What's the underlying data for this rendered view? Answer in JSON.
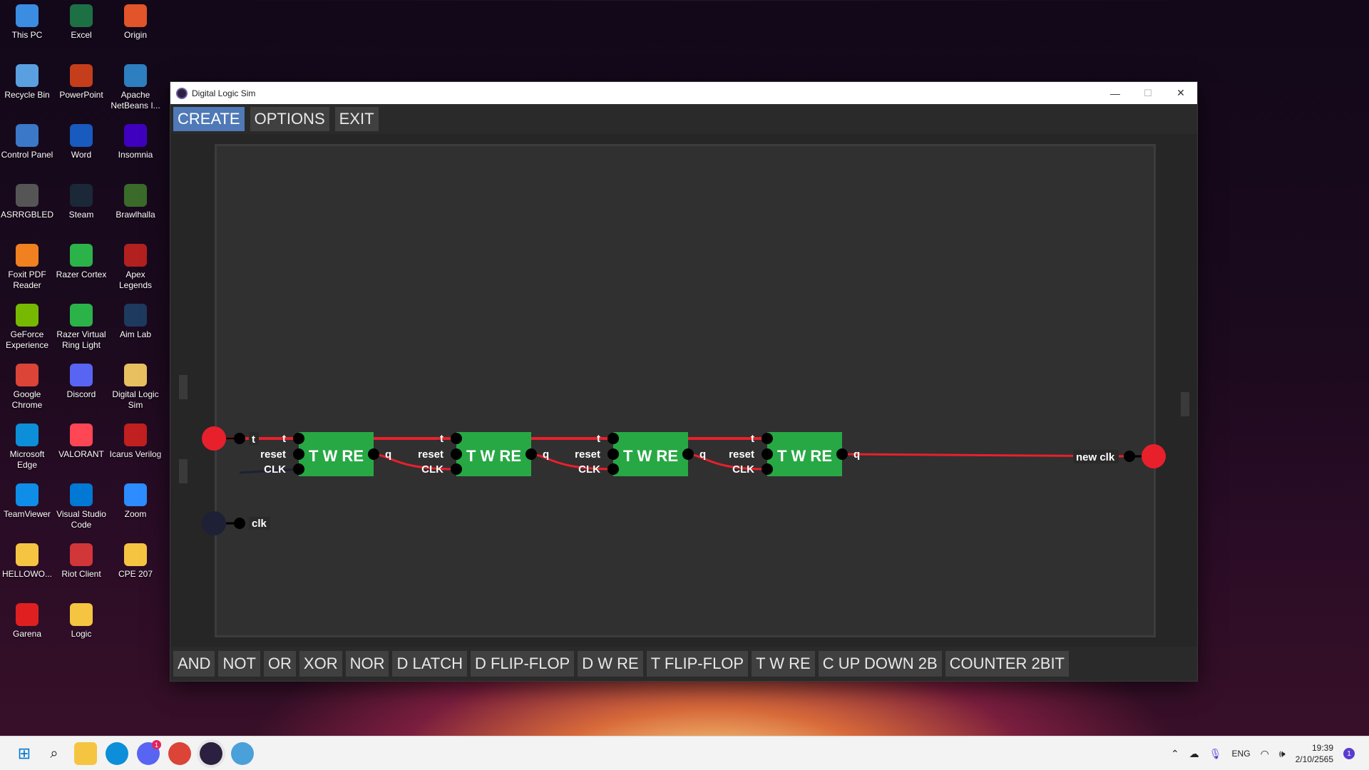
{
  "desktop": {
    "icons": [
      {
        "label": "This PC",
        "color": "#3a8de0"
      },
      {
        "label": "Excel",
        "color": "#1d7044"
      },
      {
        "label": "Origin",
        "color": "#e2542a"
      },
      {
        "label": "Recycle Bin",
        "color": "#5aa0e0"
      },
      {
        "label": "PowerPoint",
        "color": "#c43e1c"
      },
      {
        "label": "Apache NetBeans I...",
        "color": "#2d7fbf"
      },
      {
        "label": "Control Panel",
        "color": "#3b78c8"
      },
      {
        "label": "Word",
        "color": "#185abd"
      },
      {
        "label": "Insomnia",
        "color": "#4000bf"
      },
      {
        "label": "ASRRGBLED",
        "color": "#555555"
      },
      {
        "label": "Steam",
        "color": "#1b2838"
      },
      {
        "label": "Brawlhalla",
        "color": "#3a6b2a"
      },
      {
        "label": "Foxit PDF Reader",
        "color": "#f08020"
      },
      {
        "label": "Razer Cortex",
        "color": "#2bb34a"
      },
      {
        "label": "Apex Legends",
        "color": "#b32020"
      },
      {
        "label": "GeForce Experience",
        "color": "#76b900"
      },
      {
        "label": "Razer Virtual Ring Light",
        "color": "#2bb34a"
      },
      {
        "label": "Aim Lab",
        "color": "#1e3a5f"
      },
      {
        "label": "Google Chrome",
        "color": "#db4437"
      },
      {
        "label": "Discord",
        "color": "#5865f2"
      },
      {
        "label": "Digital Logic Sim",
        "color": "#e8c060"
      },
      {
        "label": "Microsoft Edge",
        "color": "#0c8fd8"
      },
      {
        "label": "VALORANT",
        "color": "#ff4655"
      },
      {
        "label": "Icarus Verilog",
        "color": "#c02020"
      },
      {
        "label": "TeamViewer",
        "color": "#0e8ee9"
      },
      {
        "label": "Visual Studio Code",
        "color": "#0078d4"
      },
      {
        "label": "Zoom",
        "color": "#2d8cff"
      },
      {
        "label": "HELLOWO...",
        "color": "#f5c542"
      },
      {
        "label": "Riot Client",
        "color": "#d13639"
      },
      {
        "label": "CPE 207",
        "color": "#f5c542"
      },
      {
        "label": "Garena",
        "color": "#e02020"
      },
      {
        "label": "Logic",
        "color": "#f5c542"
      }
    ]
  },
  "window": {
    "title": "Digital Logic Sim",
    "controls": {
      "minimize": "—",
      "maximize": "☐",
      "close": "✕"
    }
  },
  "menu": {
    "create": "CREATE",
    "options": "OPTIONS",
    "exit": "EXIT"
  },
  "circuit": {
    "inputs": [
      {
        "label": "t",
        "state": "on"
      },
      {
        "label": "clk",
        "state": "off"
      }
    ],
    "chips": [
      {
        "name": "T W RE",
        "pins_in": [
          "t",
          "reset",
          "CLK"
        ],
        "pin_out": "q"
      },
      {
        "name": "T W RE",
        "pins_in": [
          "t",
          "reset",
          "CLK"
        ],
        "pin_out": "q"
      },
      {
        "name": "T W RE",
        "pins_in": [
          "t",
          "reset",
          "CLK"
        ],
        "pin_out": "q"
      },
      {
        "name": "T W RE",
        "pins_in": [
          "t",
          "reset",
          "CLK"
        ],
        "pin_out": "q"
      }
    ],
    "output": {
      "label": "new clk",
      "state": "on"
    },
    "colors": {
      "wire_on": "#e8202c",
      "wire_off": "#1e2036",
      "chip": "#27a844",
      "pin": "#000000"
    }
  },
  "chip_palette": [
    "AND",
    "NOT",
    "OR",
    "XOR",
    "NOR",
    "D LATCH",
    "D FLIP-FLOP",
    "D W RE",
    "T FLIP-FLOP",
    "T W RE",
    "C UP DOWN 2B",
    "COUNTER 2BIT"
  ],
  "taskbar": {
    "language": "ENG",
    "time": "19:39",
    "date": "2/10/2565",
    "notification_count": "1",
    "discord_badge": "1"
  }
}
